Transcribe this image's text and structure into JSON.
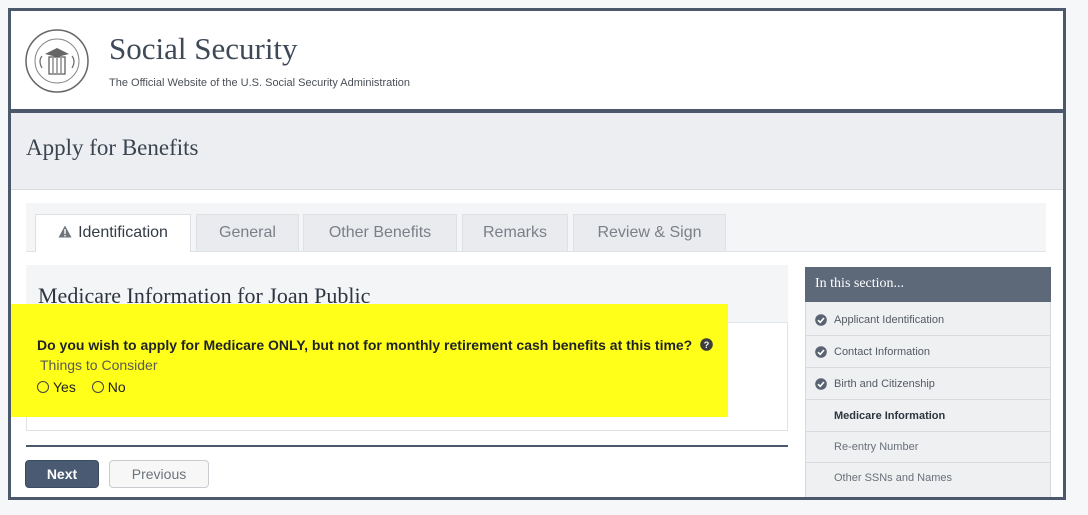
{
  "header": {
    "title": "Social Security",
    "subtitle": "The Official Website of the U.S. Social Security Administration",
    "seal_icon": "ssa-seal-icon"
  },
  "page": {
    "title": "Apply for Benefits"
  },
  "tabs": [
    {
      "label": "Identification",
      "active": true,
      "icon": "warning-icon"
    },
    {
      "label": "General"
    },
    {
      "label": "Other Benefits"
    },
    {
      "label": "Remarks"
    },
    {
      "label": "Review & Sign"
    }
  ],
  "main": {
    "heading": "Medicare Information for Joan Public",
    "question": "Do you wish to apply for Medicare ONLY, but not for monthly retirement cash benefits at this time?",
    "help_link": "Things to Consider",
    "options": [
      "Yes",
      "No"
    ],
    "highlight_color": "#ffff1a"
  },
  "buttons": {
    "next": "Next",
    "previous": "Previous"
  },
  "sidebar": {
    "heading": "In this section...",
    "items": [
      {
        "label": "Applicant Identification",
        "status": "complete"
      },
      {
        "label": "Contact Information",
        "status": "complete"
      },
      {
        "label": "Birth and Citizenship",
        "status": "complete"
      },
      {
        "label": "Medicare Information",
        "status": "current"
      },
      {
        "label": "Re-entry Number",
        "status": "upcoming"
      },
      {
        "label": "Other SSNs and Names",
        "status": "upcoming"
      }
    ]
  },
  "colors": {
    "brand_navy": "#4c596d",
    "sidebar_header": "#5d6879"
  }
}
